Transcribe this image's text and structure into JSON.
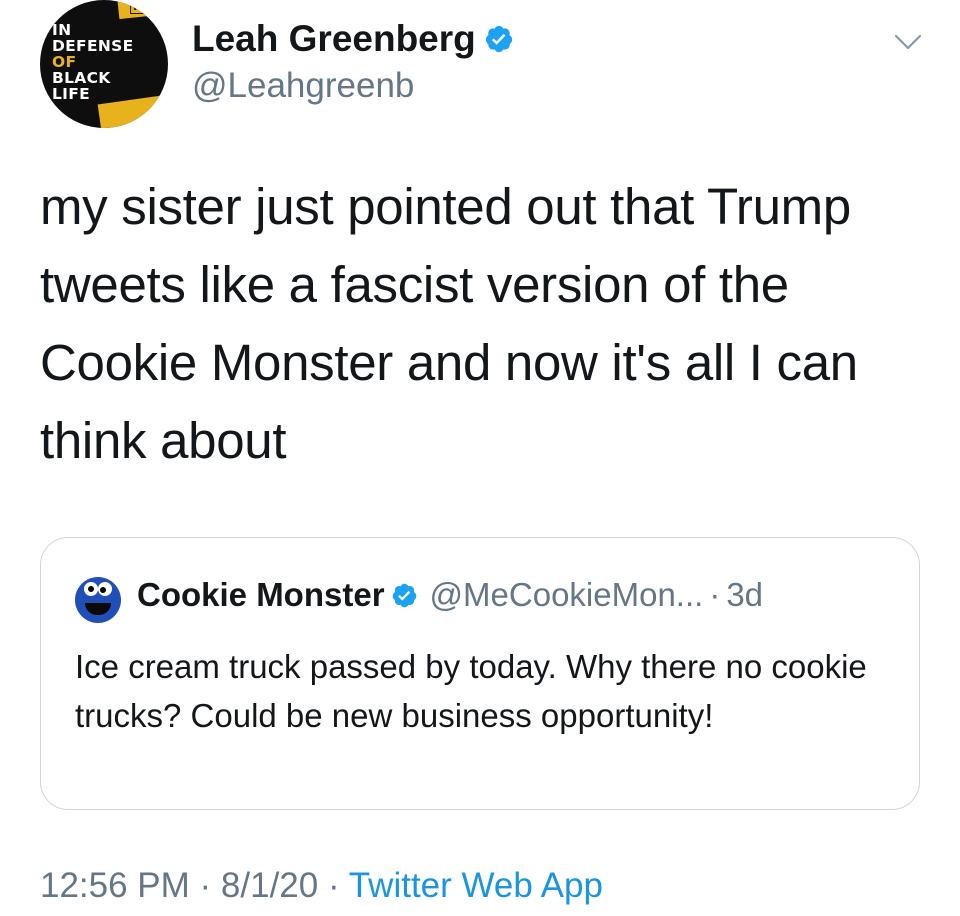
{
  "author": {
    "display_name": "Leah Greenberg",
    "handle": "@Leahgreenb",
    "verified_icon": "verified-badge-icon",
    "avatar_text": {
      "line1": "IN",
      "line2": "DEFENSE",
      "line3": "OF",
      "line4": "BLACK",
      "line5": "LIFE",
      "corner": "MA"
    }
  },
  "tweet": {
    "text": "my sister just pointed out that Trump tweets like a fascist version of the Cookie Monster and now it's all I can think about"
  },
  "quoted_tweet": {
    "display_name": "Cookie Monster",
    "handle": "@MeCookieMon...",
    "separator": "·",
    "time_ago": "3d",
    "text": "Ice cream truck passed by today. Why there no cookie trucks? Could be new business opportunity!"
  },
  "footer": {
    "time": "12:56 PM",
    "sep1": " · ",
    "date": "8/1/20",
    "sep2": " · ",
    "source": "Twitter Web App"
  },
  "colors": {
    "text_primary": "#14171a",
    "text_secondary": "#657786",
    "link": "#1b95e0",
    "verified": "#1da1f2",
    "border": "#ccd6dd"
  }
}
